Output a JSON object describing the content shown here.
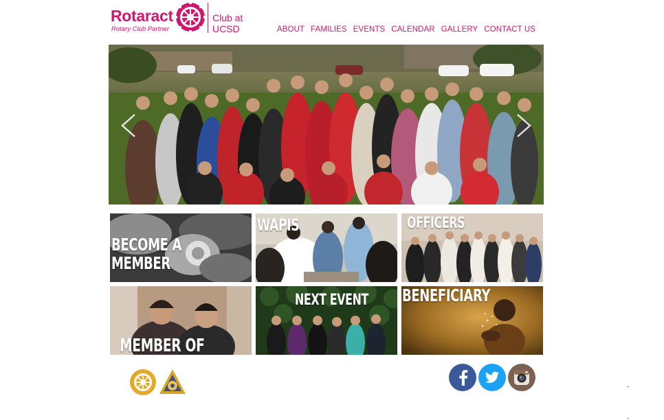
{
  "brand": {
    "name": "Rotaract",
    "partner": "Rotary Club Partner",
    "club": "Club at UCSD",
    "color": "#d1166f"
  },
  "nav": {
    "items": [
      {
        "label": "ABOUT"
      },
      {
        "label": "FAMILIES"
      },
      {
        "label": "EVENTS"
      },
      {
        "label": "CALENDAR"
      },
      {
        "label": "GALLERY"
      },
      {
        "label": "CONTACT US"
      }
    ]
  },
  "carousel": {
    "prev_icon": "chevron-left-icon",
    "next_icon": "chevron-right-icon"
  },
  "tiles": [
    {
      "line1": "BECOME A",
      "line2": "MEMBER"
    },
    {
      "line1": "WAPIs"
    },
    {
      "line1": "OFFICERS"
    },
    {
      "line1": "MEMBER OF THE MONTH"
    },
    {
      "line1": "NEXT EVENT"
    },
    {
      "line1": "BENEFICIARY"
    }
  ],
  "footer": {
    "social": [
      {
        "icon": "facebook-icon",
        "color": "#3b5998"
      },
      {
        "icon": "twitter-icon",
        "color": "#1da1f2"
      },
      {
        "icon": "instagram-icon",
        "color": "#7a6152"
      }
    ],
    "logos": [
      "rotary-wheel-icon",
      "rotaract-emblem-icon"
    ]
  }
}
